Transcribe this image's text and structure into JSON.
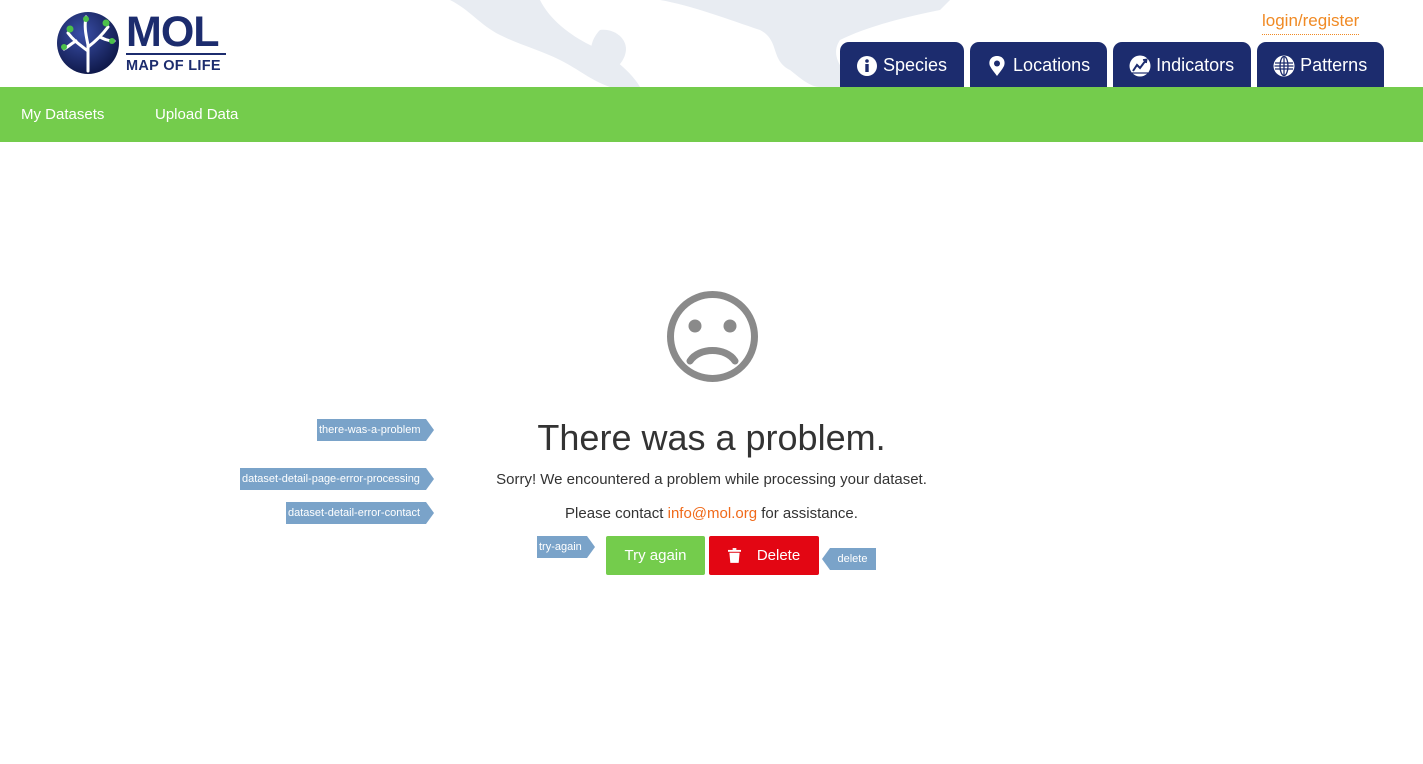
{
  "header": {
    "logo_title": "MOL",
    "logo_subtitle": "MAP OF LIFE",
    "login_label": "login/register",
    "tabs": [
      {
        "label": "Species",
        "icon": "info-icon"
      },
      {
        "label": "Locations",
        "icon": "map-pin-icon"
      },
      {
        "label": "Indicators",
        "icon": "trend-chart-icon"
      },
      {
        "label": "Patterns",
        "icon": "globe-grid-icon"
      }
    ]
  },
  "subnav": {
    "items": [
      {
        "label": "My Datasets"
      },
      {
        "label": "Upload Data"
      }
    ]
  },
  "error": {
    "icon": "sad-face-icon",
    "title": "There was a problem.",
    "message": "Sorry! We encountered a problem while processing your dataset.",
    "contact_prefix": "Please contact",
    "contact_email": "info@mol.org",
    "contact_suffix": "for assistance."
  },
  "buttons": {
    "try_again": "Try again",
    "delete": "Delete"
  },
  "tags": {
    "title_tag": "there-was-a-problem",
    "processing_tag": "dataset-detail-page-error-processing",
    "contact_tag": "dataset-detail-error-contact",
    "try_again_tag": "try-again",
    "delete_tag": "delete"
  },
  "colors": {
    "navy": "#1c2c6e",
    "green": "#74cc4c",
    "red": "#e30613",
    "orange": "#f08a24",
    "tag_blue": "#7aa3c9"
  }
}
